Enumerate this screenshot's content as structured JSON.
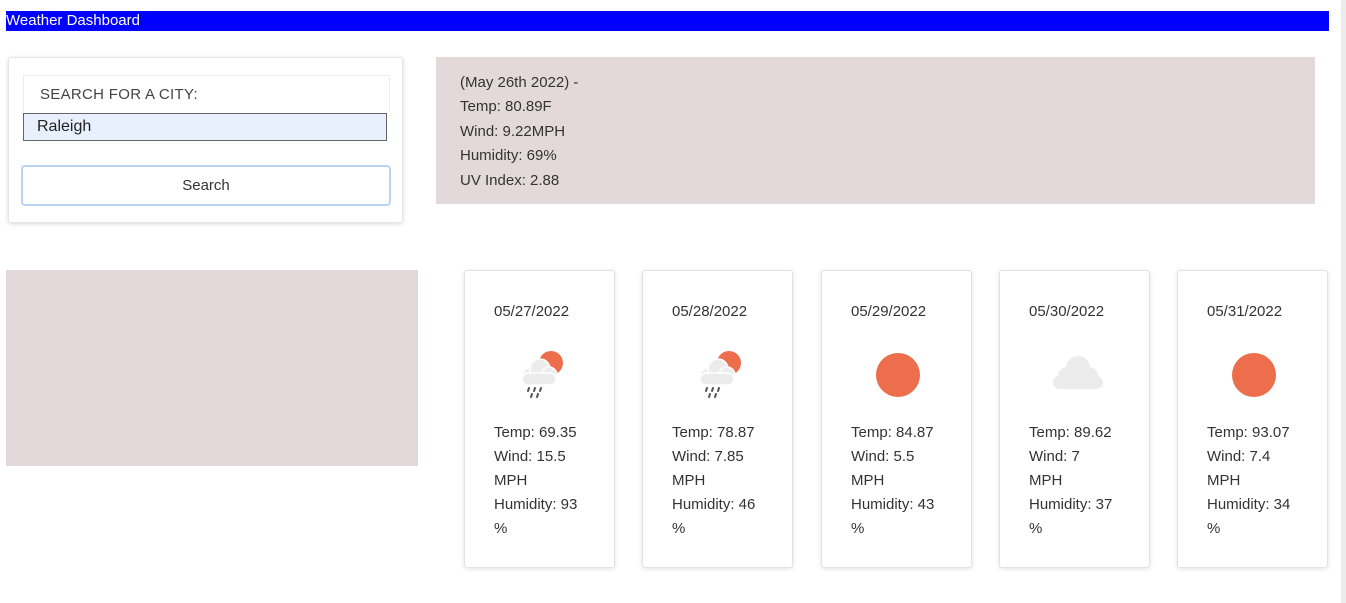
{
  "header": {
    "title": "Weather Dashboard"
  },
  "search": {
    "label": "SEARCH FOR A CITY:",
    "value": "Raleigh",
    "button_label": "Search"
  },
  "current": {
    "date_line": "(May 26th 2022) -",
    "temp": "Temp: 80.89F",
    "wind": "Wind: 9.22MPH",
    "humidity": "Humidity: 69%",
    "uv": "UV Index: 2.88"
  },
  "forecast": [
    {
      "date": "05/27/2022",
      "icon": "sun-behind-rain-cloud-icon",
      "temp": "Temp: 69.35",
      "wind": "Wind: 15.5",
      "wind_unit": "MPH",
      "humidity": "Humidity: 93",
      "humidity_unit": "%"
    },
    {
      "date": "05/28/2022",
      "icon": "sun-behind-rain-cloud-icon",
      "temp": "Temp: 78.87",
      "wind": "Wind: 7.85",
      "wind_unit": "MPH",
      "humidity": "Humidity: 46",
      "humidity_unit": "%"
    },
    {
      "date": "05/29/2022",
      "icon": "sun-icon",
      "temp": "Temp: 84.87",
      "wind": "Wind: 5.5",
      "wind_unit": "MPH",
      "humidity": "Humidity: 43",
      "humidity_unit": "%"
    },
    {
      "date": "05/30/2022",
      "icon": "cloud-icon",
      "temp": "Temp: 89.62",
      "wind": "Wind: 7",
      "wind_unit": "MPH",
      "humidity": "Humidity: 37",
      "humidity_unit": "%"
    },
    {
      "date": "05/31/2022",
      "icon": "sun-icon",
      "temp": "Temp: 93.07",
      "wind": "Wind: 7.4",
      "wind_unit": "MPH",
      "humidity": "Humidity: 34",
      "humidity_unit": "%"
    }
  ],
  "colors": {
    "header_bg": "#0000ff",
    "panel_bg": "#e3d9da",
    "sun": "#ec6e4c",
    "cloud": "#ececec",
    "input_bg": "#e8f0fe",
    "button_border": "#b9d2f5"
  }
}
